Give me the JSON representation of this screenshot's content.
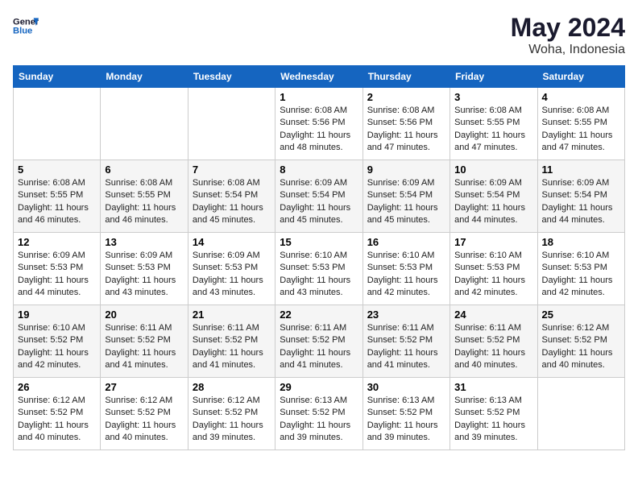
{
  "header": {
    "logo_general": "General",
    "logo_blue": "Blue",
    "month": "May 2024",
    "location": "Woha, Indonesia"
  },
  "days_of_week": [
    "Sunday",
    "Monday",
    "Tuesday",
    "Wednesday",
    "Thursday",
    "Friday",
    "Saturday"
  ],
  "weeks": [
    [
      {
        "day": "",
        "info": ""
      },
      {
        "day": "",
        "info": ""
      },
      {
        "day": "",
        "info": ""
      },
      {
        "day": "1",
        "sunrise": "Sunrise: 6:08 AM",
        "sunset": "Sunset: 5:56 PM",
        "daylight": "Daylight: 11 hours and 48 minutes."
      },
      {
        "day": "2",
        "sunrise": "Sunrise: 6:08 AM",
        "sunset": "Sunset: 5:56 PM",
        "daylight": "Daylight: 11 hours and 47 minutes."
      },
      {
        "day": "3",
        "sunrise": "Sunrise: 6:08 AM",
        "sunset": "Sunset: 5:55 PM",
        "daylight": "Daylight: 11 hours and 47 minutes."
      },
      {
        "day": "4",
        "sunrise": "Sunrise: 6:08 AM",
        "sunset": "Sunset: 5:55 PM",
        "daylight": "Daylight: 11 hours and 47 minutes."
      }
    ],
    [
      {
        "day": "5",
        "sunrise": "Sunrise: 6:08 AM",
        "sunset": "Sunset: 5:55 PM",
        "daylight": "Daylight: 11 hours and 46 minutes."
      },
      {
        "day": "6",
        "sunrise": "Sunrise: 6:08 AM",
        "sunset": "Sunset: 5:55 PM",
        "daylight": "Daylight: 11 hours and 46 minutes."
      },
      {
        "day": "7",
        "sunrise": "Sunrise: 6:08 AM",
        "sunset": "Sunset: 5:54 PM",
        "daylight": "Daylight: 11 hours and 45 minutes."
      },
      {
        "day": "8",
        "sunrise": "Sunrise: 6:09 AM",
        "sunset": "Sunset: 5:54 PM",
        "daylight": "Daylight: 11 hours and 45 minutes."
      },
      {
        "day": "9",
        "sunrise": "Sunrise: 6:09 AM",
        "sunset": "Sunset: 5:54 PM",
        "daylight": "Daylight: 11 hours and 45 minutes."
      },
      {
        "day": "10",
        "sunrise": "Sunrise: 6:09 AM",
        "sunset": "Sunset: 5:54 PM",
        "daylight": "Daylight: 11 hours and 44 minutes."
      },
      {
        "day": "11",
        "sunrise": "Sunrise: 6:09 AM",
        "sunset": "Sunset: 5:54 PM",
        "daylight": "Daylight: 11 hours and 44 minutes."
      }
    ],
    [
      {
        "day": "12",
        "sunrise": "Sunrise: 6:09 AM",
        "sunset": "Sunset: 5:53 PM",
        "daylight": "Daylight: 11 hours and 44 minutes."
      },
      {
        "day": "13",
        "sunrise": "Sunrise: 6:09 AM",
        "sunset": "Sunset: 5:53 PM",
        "daylight": "Daylight: 11 hours and 43 minutes."
      },
      {
        "day": "14",
        "sunrise": "Sunrise: 6:09 AM",
        "sunset": "Sunset: 5:53 PM",
        "daylight": "Daylight: 11 hours and 43 minutes."
      },
      {
        "day": "15",
        "sunrise": "Sunrise: 6:10 AM",
        "sunset": "Sunset: 5:53 PM",
        "daylight": "Daylight: 11 hours and 43 minutes."
      },
      {
        "day": "16",
        "sunrise": "Sunrise: 6:10 AM",
        "sunset": "Sunset: 5:53 PM",
        "daylight": "Daylight: 11 hours and 42 minutes."
      },
      {
        "day": "17",
        "sunrise": "Sunrise: 6:10 AM",
        "sunset": "Sunset: 5:53 PM",
        "daylight": "Daylight: 11 hours and 42 minutes."
      },
      {
        "day": "18",
        "sunrise": "Sunrise: 6:10 AM",
        "sunset": "Sunset: 5:53 PM",
        "daylight": "Daylight: 11 hours and 42 minutes."
      }
    ],
    [
      {
        "day": "19",
        "sunrise": "Sunrise: 6:10 AM",
        "sunset": "Sunset: 5:52 PM",
        "daylight": "Daylight: 11 hours and 42 minutes."
      },
      {
        "day": "20",
        "sunrise": "Sunrise: 6:11 AM",
        "sunset": "Sunset: 5:52 PM",
        "daylight": "Daylight: 11 hours and 41 minutes."
      },
      {
        "day": "21",
        "sunrise": "Sunrise: 6:11 AM",
        "sunset": "Sunset: 5:52 PM",
        "daylight": "Daylight: 11 hours and 41 minutes."
      },
      {
        "day": "22",
        "sunrise": "Sunrise: 6:11 AM",
        "sunset": "Sunset: 5:52 PM",
        "daylight": "Daylight: 11 hours and 41 minutes."
      },
      {
        "day": "23",
        "sunrise": "Sunrise: 6:11 AM",
        "sunset": "Sunset: 5:52 PM",
        "daylight": "Daylight: 11 hours and 41 minutes."
      },
      {
        "day": "24",
        "sunrise": "Sunrise: 6:11 AM",
        "sunset": "Sunset: 5:52 PM",
        "daylight": "Daylight: 11 hours and 40 minutes."
      },
      {
        "day": "25",
        "sunrise": "Sunrise: 6:12 AM",
        "sunset": "Sunset: 5:52 PM",
        "daylight": "Daylight: 11 hours and 40 minutes."
      }
    ],
    [
      {
        "day": "26",
        "sunrise": "Sunrise: 6:12 AM",
        "sunset": "Sunset: 5:52 PM",
        "daylight": "Daylight: 11 hours and 40 minutes."
      },
      {
        "day": "27",
        "sunrise": "Sunrise: 6:12 AM",
        "sunset": "Sunset: 5:52 PM",
        "daylight": "Daylight: 11 hours and 40 minutes."
      },
      {
        "day": "28",
        "sunrise": "Sunrise: 6:12 AM",
        "sunset": "Sunset: 5:52 PM",
        "daylight": "Daylight: 11 hours and 39 minutes."
      },
      {
        "day": "29",
        "sunrise": "Sunrise: 6:13 AM",
        "sunset": "Sunset: 5:52 PM",
        "daylight": "Daylight: 11 hours and 39 minutes."
      },
      {
        "day": "30",
        "sunrise": "Sunrise: 6:13 AM",
        "sunset": "Sunset: 5:52 PM",
        "daylight": "Daylight: 11 hours and 39 minutes."
      },
      {
        "day": "31",
        "sunrise": "Sunrise: 6:13 AM",
        "sunset": "Sunset: 5:52 PM",
        "daylight": "Daylight: 11 hours and 39 minutes."
      },
      {
        "day": "",
        "info": ""
      }
    ]
  ]
}
